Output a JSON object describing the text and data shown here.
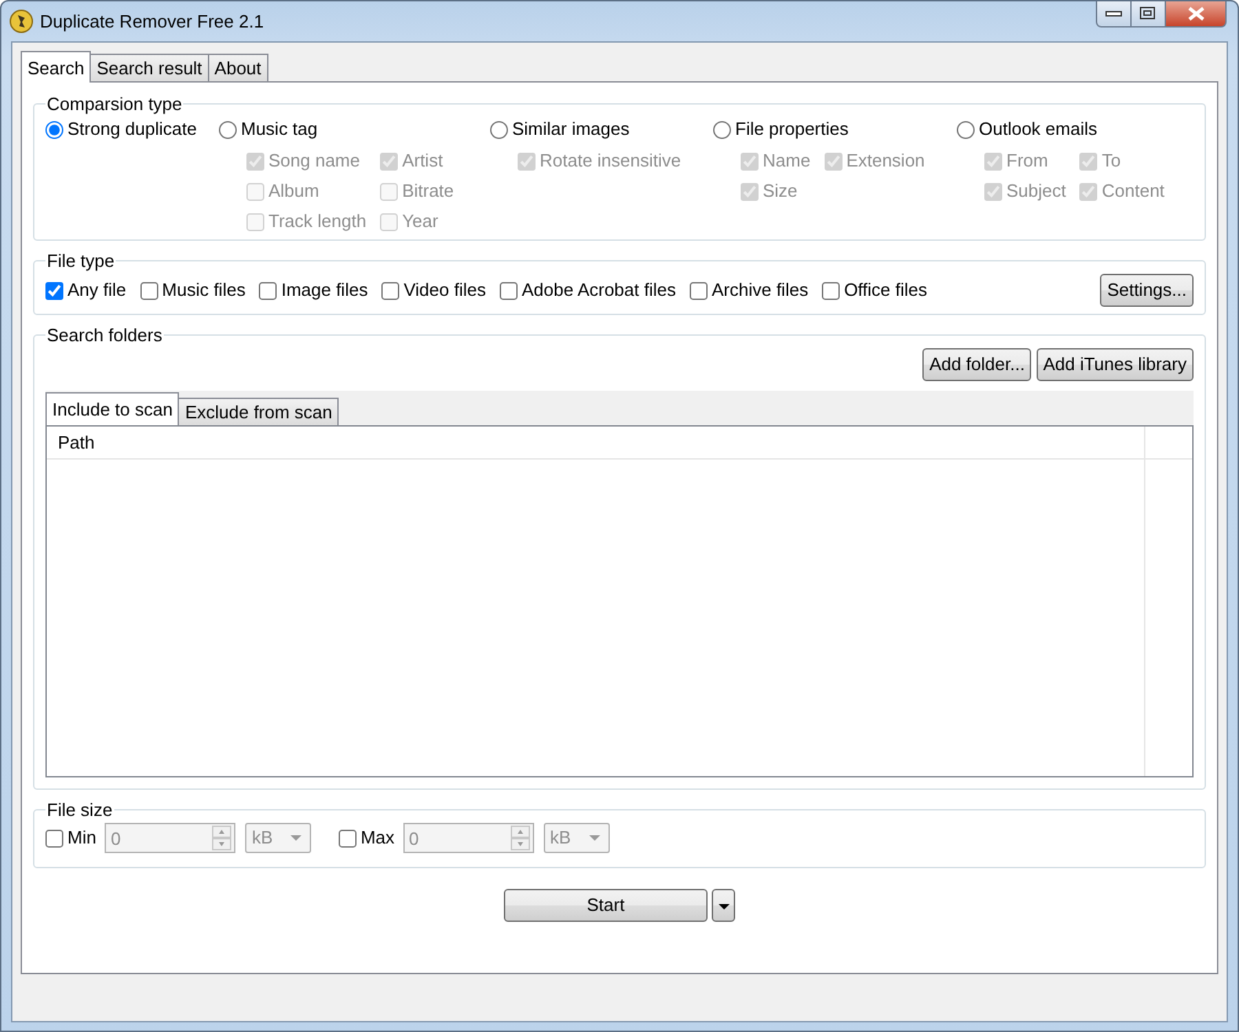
{
  "window": {
    "title": "Duplicate Remover Free 2.1"
  },
  "tabs": [
    {
      "label": "Search",
      "selected": true
    },
    {
      "label": "Search result",
      "selected": false
    },
    {
      "label": "About",
      "selected": false
    }
  ],
  "comparison": {
    "title": "Comparsion type",
    "options": [
      {
        "label": "Strong duplicate",
        "selected": true
      },
      {
        "label": "Music tag",
        "selected": false,
        "checks": [
          {
            "label": "Song name",
            "checked": true,
            "disabled": true
          },
          {
            "label": "Artist",
            "checked": true,
            "disabled": true
          },
          {
            "label": "Album",
            "checked": false,
            "disabled": true
          },
          {
            "label": "Bitrate",
            "checked": false,
            "disabled": true
          },
          {
            "label": "Track length",
            "checked": false,
            "disabled": true
          },
          {
            "label": "Year",
            "checked": false,
            "disabled": true
          }
        ]
      },
      {
        "label": "Similar images",
        "selected": false,
        "checks": [
          {
            "label": "Rotate insensitive",
            "checked": true,
            "disabled": true
          }
        ]
      },
      {
        "label": "File properties",
        "selected": false,
        "checks": [
          {
            "label": "Name",
            "checked": true,
            "disabled": true
          },
          {
            "label": "Extension",
            "checked": true,
            "disabled": true
          },
          {
            "label": "Size",
            "checked": true,
            "disabled": true
          }
        ]
      },
      {
        "label": "Outlook emails",
        "selected": false,
        "checks": [
          {
            "label": "From",
            "checked": true,
            "disabled": true
          },
          {
            "label": "To",
            "checked": true,
            "disabled": true
          },
          {
            "label": "Subject",
            "checked": true,
            "disabled": true
          },
          {
            "label": "Content",
            "checked": true,
            "disabled": true
          }
        ]
      }
    ]
  },
  "file_type": {
    "title": "File type",
    "items": [
      {
        "label": "Any file",
        "checked": true
      },
      {
        "label": "Music files",
        "checked": false
      },
      {
        "label": "Image files",
        "checked": false
      },
      {
        "label": "Video files",
        "checked": false
      },
      {
        "label": "Adobe Acrobat files",
        "checked": false
      },
      {
        "label": "Archive files",
        "checked": false
      },
      {
        "label": "Office files",
        "checked": false
      }
    ],
    "button": "Settings..."
  },
  "search_folders": {
    "title": "Search folders",
    "buttons": [
      "Add folder...",
      "Add iTunes library"
    ],
    "tabs": [
      {
        "label": "Include to scan",
        "selected": true
      },
      {
        "label": "Exclude from scan",
        "selected": false
      }
    ],
    "columns": [
      "Path"
    ]
  },
  "file_size": {
    "title": "File size",
    "limits": [
      {
        "label": "Min",
        "checked": false,
        "value": "0",
        "unit": "kB"
      },
      {
        "label": "Max",
        "checked": false,
        "value": "0",
        "unit": "kB"
      }
    ]
  },
  "start_button": "Start"
}
